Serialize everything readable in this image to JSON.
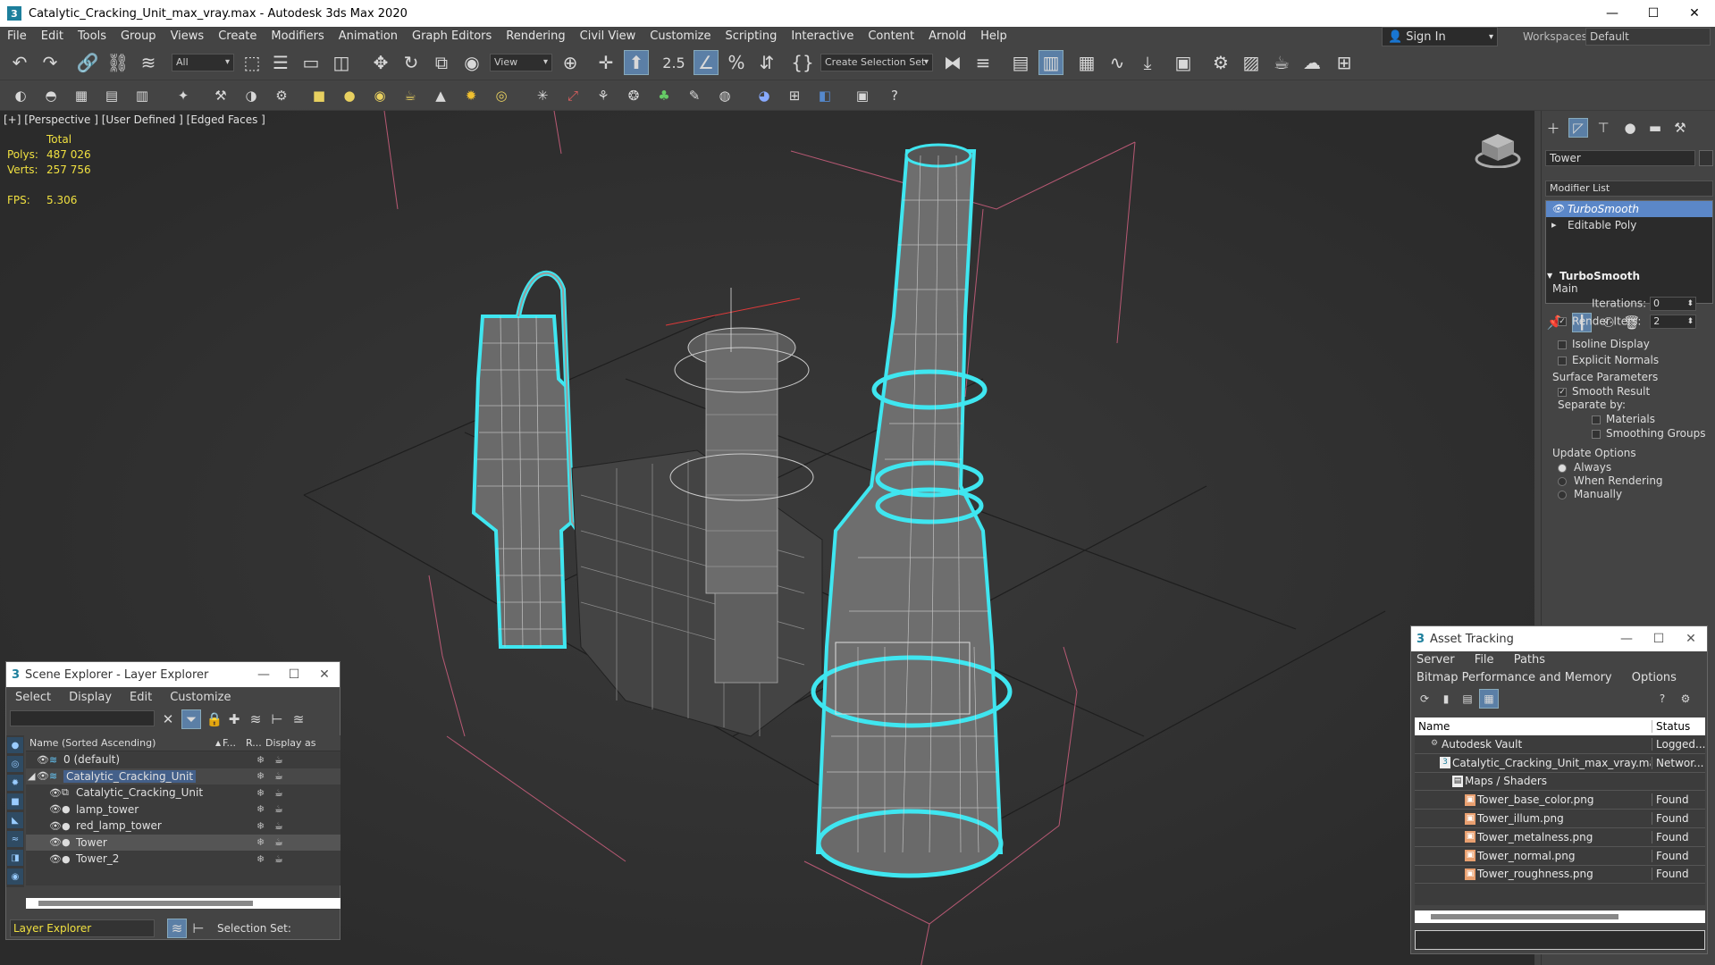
{
  "window": {
    "title": "Catalytic_Cracking_Unit_max_vray.max - Autodesk 3ds Max 2020",
    "app_icon": "3"
  },
  "menu": [
    "File",
    "Edit",
    "Tools",
    "Group",
    "Views",
    "Create",
    "Modifiers",
    "Animation",
    "Graph Editors",
    "Rendering",
    "Civil View",
    "Customize",
    "Scripting",
    "Interactive",
    "Content",
    "Arnold",
    "Help"
  ],
  "signin": {
    "label": "Sign In"
  },
  "workspace": {
    "label": "Workspaces:",
    "value": "Default"
  },
  "toolbar": {
    "filter": "All",
    "ref_coord": "View",
    "selection_set": "Create Selection Set",
    "snap_value": "2.5"
  },
  "viewport": {
    "label": "[+] [Perspective ] [User Defined ] [Edged Faces ]",
    "stats_header": "Total",
    "polys_label": "Polys:",
    "polys": "487 026",
    "verts_label": "Verts:",
    "verts": "257 756",
    "fps_label": "FPS:",
    "fps": "5.306"
  },
  "command_panel": {
    "object_name": "Tower",
    "modifier_list": "Modifier List",
    "stack": [
      "TurboSmooth",
      "Editable Poly"
    ],
    "rollout_title": "TurboSmooth",
    "main_label": "Main",
    "iterations_label": "Iterations:",
    "iterations": "0",
    "render_iters_label": "Render Iters:",
    "render_iters": "2",
    "isoline": "Isoline Display",
    "explicit_normals": "Explicit Normals",
    "surface_params": "Surface Parameters",
    "smooth_result": "Smooth Result",
    "separate_by": "Separate by:",
    "materials": "Materials",
    "smoothing_groups": "Smoothing Groups",
    "update_options": "Update Options",
    "always": "Always",
    "when_rendering": "When Rendering",
    "manually": "Manually"
  },
  "scene_explorer": {
    "title": "Scene Explorer - Layer Explorer",
    "menu": [
      "Select",
      "Display",
      "Edit",
      "Customize"
    ],
    "col_name": "Name (Sorted Ascending)",
    "col_f": "F...",
    "col_r": "R...",
    "col_display": "Display as",
    "rows": [
      {
        "name": "0 (default)"
      },
      {
        "name": "Catalytic_Cracking_Unit"
      },
      {
        "name": "Catalytic_Cracking_Unit"
      },
      {
        "name": "lamp_tower"
      },
      {
        "name": "red_lamp_tower"
      },
      {
        "name": "Tower"
      },
      {
        "name": "Tower_2"
      }
    ],
    "footer_explorer": "Layer Explorer",
    "footer_selection": "Selection Set:"
  },
  "asset_tracking": {
    "title": "Asset Tracking",
    "menu1": [
      "Server",
      "File",
      "Paths"
    ],
    "menu2": [
      "Bitmap Performance and Memory",
      "Options"
    ],
    "col_name": "Name",
    "col_status": "Status",
    "rows": [
      {
        "name": "Autodesk Vault",
        "status": "Logged..."
      },
      {
        "name": "Catalytic_Cracking_Unit_max_vray.max",
        "status": "Networ..."
      },
      {
        "name": "Maps / Shaders",
        "status": ""
      },
      {
        "name": "Tower_base_color.png",
        "status": "Found"
      },
      {
        "name": "Tower_illum.png",
        "status": "Found"
      },
      {
        "name": "Tower_metalness.png",
        "status": "Found"
      },
      {
        "name": "Tower_normal.png",
        "status": "Found"
      },
      {
        "name": "Tower_roughness.png",
        "status": "Found"
      }
    ]
  },
  "colors": {
    "accent": "#5b87c8",
    "selection_outline": "#3fe6f0",
    "stats": "#f0e040"
  }
}
